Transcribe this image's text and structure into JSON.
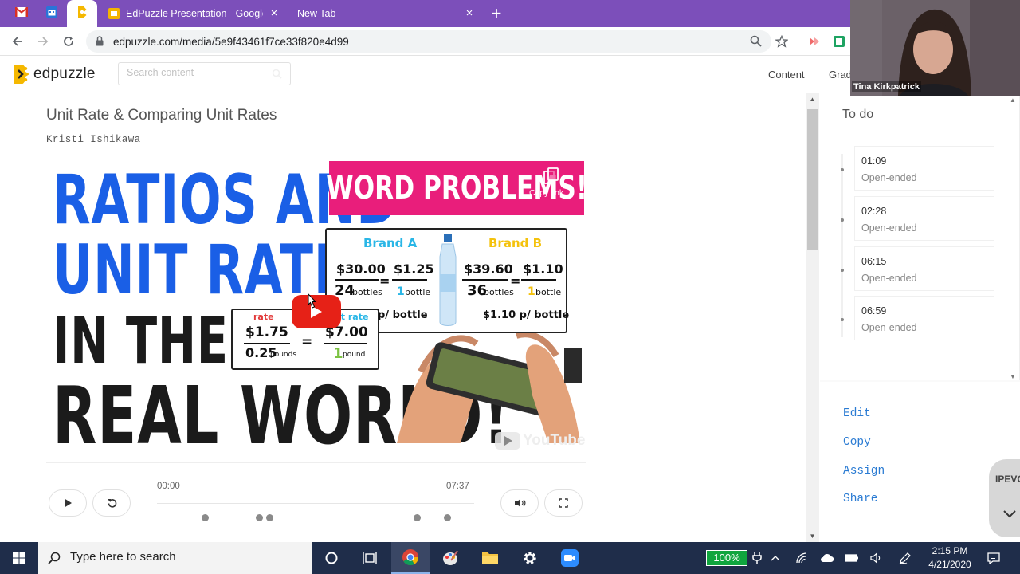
{
  "browser": {
    "tabs": [
      {
        "title": "EdPuzzle Presentation - Google Slides",
        "close": "×"
      },
      {
        "title": "New Tab",
        "close": "×"
      }
    ],
    "new_tab": "+",
    "url": "edpuzzle.com/media/5e9f43461f7ce33f820e4d99"
  },
  "header": {
    "logo_text": "edpuzzle",
    "search_placeholder": "Search content",
    "nav": [
      "Content",
      "Grad"
    ]
  },
  "video": {
    "title": "Unit Rate & Comparing Unit Rates",
    "author": "Kristi Ishikawa",
    "thumbnail": {
      "line1": "RATIOS AND",
      "line2": "UNIT RATES",
      "line3": "IN THE",
      "line4": "REAL WORLD!",
      "banner": "WORD PROBLEMS!",
      "copy_link": "Copy link",
      "brand_a": "Brand A",
      "brand_b": "Brand B",
      "a_price": "$30.00",
      "a_qty_num": "24",
      "a_qty_unit": "bottles",
      "a_unit_price": "$1.25",
      "a_unit_num": "1",
      "a_unit_word": "bottle",
      "a_per": "p/ bottle",
      "b_price": "$39.60",
      "b_qty_num": "36",
      "b_qty_unit": "bottles",
      "b_unit_price": "$1.10",
      "b_unit_num": "1",
      "b_unit_word": "bottle",
      "b_per": "$1.10 p/ bottle",
      "rate_label": "rate",
      "unit_rate_label": "it rate",
      "rate_price": "$1.75",
      "rate_qty": "0.25",
      "rate_qty_unit": "pounds",
      "unit_price": "$7.00",
      "unit_qty": "1",
      "unit_qty_unit": "pound",
      "equals": "=",
      "youtube": "YouTube"
    },
    "current_time": "00:00",
    "duration": "07:37",
    "question_marker_times": [
      "01:09",
      "02:28",
      "02:42",
      "06:15",
      "06:59"
    ]
  },
  "sidebar": {
    "todo_title": "To do",
    "todo": [
      {
        "time": "01:09",
        "kind": "Open-ended"
      },
      {
        "time": "02:28",
        "kind": "Open-ended"
      },
      {
        "time": "06:15",
        "kind": "Open-ended"
      },
      {
        "time": "06:59",
        "kind": "Open-ended"
      }
    ],
    "actions": [
      "Edit",
      "Copy",
      "Assign",
      "Share"
    ]
  },
  "webcam": {
    "name": "Tina Kirkpatrick"
  },
  "ipevo": {
    "label": "IPEVO"
  },
  "taskbar": {
    "search_placeholder": "Type here to search",
    "battery": "100%",
    "time": "2:15 PM",
    "date": "4/21/2020"
  },
  "colors": {
    "tabstrip": "#7c4fba",
    "edpuzzle_yellow": "#f5b800",
    "banner_pink": "#e91e7b",
    "title_blue": "#1a5fe6",
    "action_blue": "#2a7bd3",
    "taskbar": "#1f2d4a"
  }
}
